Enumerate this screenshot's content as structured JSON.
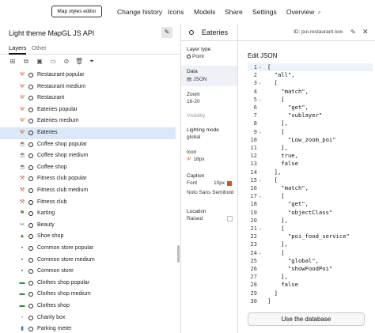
{
  "topbar": {
    "styles_button": "Map styles editor",
    "nav": [
      {
        "label": "Change history"
      },
      {
        "label": "Icons"
      },
      {
        "label": "Models"
      },
      {
        "label": "Share"
      },
      {
        "label": "Settings"
      },
      {
        "label": "Overview"
      }
    ],
    "external_icon": "↗"
  },
  "left": {
    "title": "Light theme MapGL JS API",
    "tabs": [
      {
        "label": "Layers"
      },
      {
        "label": "Other"
      }
    ],
    "toolbar_icons": [
      "add-layer-icon",
      "duplicate-icon",
      "group-icon",
      "folder-icon",
      "hide-icon",
      "delete-icon",
      "filter-icon"
    ],
    "layers": [
      {
        "label": "Restaurant popular",
        "icon": "fork-knife",
        "color": "#c8552c"
      },
      {
        "label": "Restaurant medium",
        "icon": "fork-knife",
        "color": "#c8552c"
      },
      {
        "label": "Restaurant",
        "icon": "fork-knife",
        "color": "#c8552c"
      },
      {
        "label": "Eateries popular",
        "icon": "fork-knife",
        "color": "#c8552c"
      },
      {
        "label": "Eateries medium",
        "icon": "fork-knife",
        "color": "#c8552c"
      },
      {
        "label": "Eateries",
        "icon": "fork-knife",
        "color": "#c8552c"
      },
      {
        "label": "Coffee shop popular",
        "icon": "cup",
        "color": "#c8552c"
      },
      {
        "label": "Coffee shop medium",
        "icon": "cup",
        "color": "#c8552c"
      },
      {
        "label": "Coffee shop",
        "icon": "cup",
        "color": "#c8552c"
      },
      {
        "label": "Fitness club popular",
        "icon": "dumbbell",
        "color": "#c8552c"
      },
      {
        "label": "Fitness club medium",
        "icon": "dumbbell",
        "color": "#c8552c"
      },
      {
        "label": "Fitness club",
        "icon": "dumbbell",
        "color": "#c8552c"
      },
      {
        "label": "Karting",
        "icon": "flag",
        "color": "#3a8a3a"
      },
      {
        "label": "Beauty",
        "icon": "scissors",
        "color": "#3a8a3a"
      },
      {
        "label": "Shoe shop",
        "icon": "shoe",
        "color": "#3a8a3a"
      },
      {
        "label": "Common store popular",
        "icon": "bag",
        "color": "#3a8a3a"
      },
      {
        "label": "Common store medium",
        "icon": "bag",
        "color": "#3a8a3a"
      },
      {
        "label": "Common store",
        "icon": "bag",
        "color": "#3a8a3a"
      },
      {
        "label": "Clothes shop popular",
        "icon": "shirt",
        "color": "#3a8a3a"
      },
      {
        "label": "Clothes shop medium",
        "icon": "shirt",
        "color": "#3a8a3a"
      },
      {
        "label": "Clothes shop",
        "icon": "shirt",
        "color": "#3a8a3a"
      },
      {
        "label": "Charity box",
        "icon": "box",
        "color": "#3a8a3a"
      },
      {
        "label": "Parking meter",
        "icon": "meter",
        "color": "#3a7ac8"
      }
    ],
    "selected_index": 5
  },
  "middle": {
    "layer_type_label": "Layer type",
    "layer_type_value": "Point",
    "data_label": "Data",
    "data_value": "JSON",
    "zoom_label": "Zoom",
    "zoom_value": "16-20",
    "visibility_label": "Visibility",
    "lighting_label": "Lighting mode",
    "lighting_value": "global",
    "icon_label": "Icon",
    "icon_value": "18px",
    "caption_label": "Caption",
    "caption_font_label": "Font",
    "caption_size": "10px",
    "caption_font_name": "Noto Sans Semibold",
    "caption_color": "#c8552c",
    "location_label": "Location",
    "location_value": "Raised"
  },
  "right": {
    "title": "Eateries",
    "id_text": "ID: poi-restaurant-low",
    "edit_label": "Edit JSON",
    "code_lines": [
      {
        "n": "1",
        "fold": "⌄",
        "text": "["
      },
      {
        "n": "2",
        "fold": "",
        "text": "  \"all\","
      },
      {
        "n": "3",
        "fold": "⌄",
        "text": "  ["
      },
      {
        "n": "4",
        "fold": "",
        "text": "    \"match\","
      },
      {
        "n": "5",
        "fold": "⌄",
        "text": "    ["
      },
      {
        "n": "6",
        "fold": "",
        "text": "      \"get\","
      },
      {
        "n": "7",
        "fold": "",
        "text": "      \"sublayer\""
      },
      {
        "n": "8",
        "fold": "",
        "text": "    ],"
      },
      {
        "n": "9",
        "fold": "⌄",
        "text": "    ["
      },
      {
        "n": "10",
        "fold": "",
        "text": "      \"Low_zoom_poi\""
      },
      {
        "n": "11",
        "fold": "",
        "text": "    ],"
      },
      {
        "n": "12",
        "fold": "",
        "text": "    true,"
      },
      {
        "n": "13",
        "fold": "",
        "text": "    false"
      },
      {
        "n": "14",
        "fold": "",
        "text": "  ],"
      },
      {
        "n": "15",
        "fold": "⌄",
        "text": "  ["
      },
      {
        "n": "16",
        "fold": "",
        "text": "    \"match\","
      },
      {
        "n": "17",
        "fold": "⌄",
        "text": "    ["
      },
      {
        "n": "18",
        "fold": "",
        "text": "      \"get\","
      },
      {
        "n": "19",
        "fold": "",
        "text": "      \"objectClass\""
      },
      {
        "n": "20",
        "fold": "",
        "text": "    ],"
      },
      {
        "n": "21",
        "fold": "⌄",
        "text": "    ["
      },
      {
        "n": "22",
        "fold": "",
        "text": "      \"poi_food_service\""
      },
      {
        "n": "23",
        "fold": "",
        "text": "    ],"
      },
      {
        "n": "24",
        "fold": "⌄",
        "text": "    ["
      },
      {
        "n": "25",
        "fold": "",
        "text": "      \"global\","
      },
      {
        "n": "26",
        "fold": "",
        "text": "      \"showFoodPoi\""
      },
      {
        "n": "27",
        "fold": "",
        "text": "    ],"
      },
      {
        "n": "28",
        "fold": "",
        "text": "    false"
      },
      {
        "n": "29",
        "fold": "",
        "text": "  ]"
      },
      {
        "n": "30",
        "fold": "",
        "text": "]"
      }
    ],
    "use_db_button": "Use the database"
  }
}
